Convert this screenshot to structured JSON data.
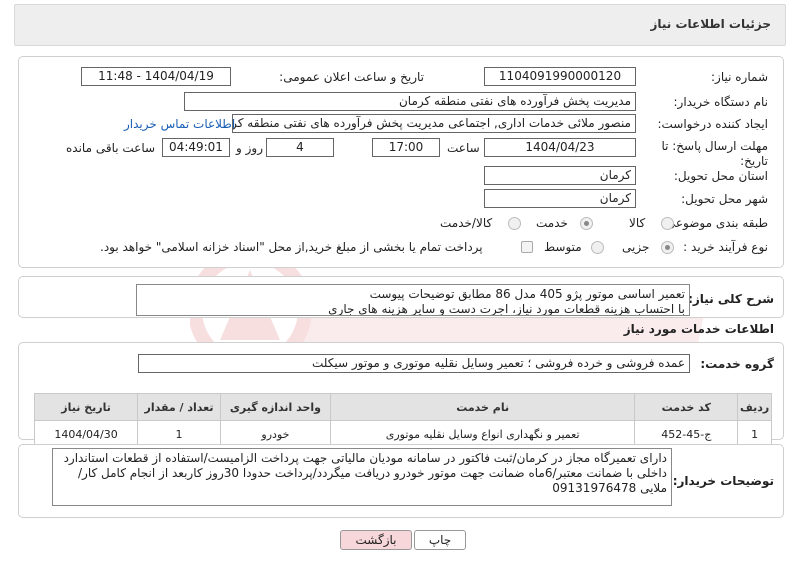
{
  "header": {
    "title": "جزئیات اطلاعات نیاز"
  },
  "form": {
    "need_number_label": "شماره نیاز:",
    "need_number": "1104091990000120",
    "announce_label": "تاریخ و ساعت اعلان عمومی:",
    "announce_value": "1404/04/19 - 11:48",
    "buyer_label": "نام دستگاه خریدار:",
    "buyer_value": "مدیریت پخش فرآورده های نفتی منطقه کرمان",
    "creator_label": "ایجاد کننده درخواست:",
    "creator_value": "منصور ملائی خدمات اداری, اجتماعی  مدیریت پخش فرآورده های نفتی منطقه کرمان",
    "contact_link": "اطلاعات تماس خریدار",
    "deadline_label": "مهلت ارسال پاسخ: تا تاریخ:",
    "deadline_date": "1404/04/23",
    "time_label": "ساعت",
    "deadline_time": "17:00",
    "days_value": "4",
    "days_label": "روز و",
    "remaining_time": "04:49:01",
    "remaining_label": "ساعت باقی مانده",
    "province_label": "استان محل تحویل:",
    "province_value": "کرمان",
    "city_label": "شهر محل تحویل:",
    "city_value": "کرمان",
    "category_label": "طبقه بندی موضوعی:",
    "category_options": [
      "کالا",
      "خدمت",
      "کالا/خدمت"
    ],
    "category_selected": "خدمت",
    "process_label": "نوع فرآیند خرید :",
    "process_options": [
      "جزیی",
      "متوسط"
    ],
    "process_selected": "جزیی",
    "payment_note": "پرداخت تمام یا بخشی از مبلغ خرید,از محل \"اسناد خزانه اسلامی\" خواهد بود."
  },
  "summary": {
    "label": "شرح کلی نیاز:",
    "text": "تعمیر اساسی موتور پژو 405 مدل 86 مطابق توضیحات پیوست\nبا احتساب هزینه قطعات مورد نیاز، اجرت دست و سایر هزینه های جاری"
  },
  "services": {
    "section_title": "اطلاعات خدمات مورد نیاز",
    "group_label": "گروه خدمت:",
    "group_value": "عمده فروشی و خرده فروشی ؛ تعمیر وسایل نقلیه موتوری و موتور سیکلت",
    "columns": [
      "ردیف",
      "کد خدمت",
      "نام خدمت",
      "واحد اندازه گیری",
      "تعداد / مقدار",
      "تاریخ نیاز"
    ],
    "rows": [
      [
        "1",
        "ج-45-452",
        "تعمیر و نگهداری انواع وسایل نقلیه موتوری",
        "خودرو",
        "1",
        "1404/04/30"
      ]
    ]
  },
  "buyer_notes": {
    "label": "توضیحات خریدار:",
    "text": "دارای تعمیرگاه مجاز در کرمان/ثبت فاکتور در سامانه مودیان مالیاتی جهت پرداخت الزامیست/استفاده از قطعات استاندارد داخلی با ضمانت معتبر/6ماه ضمانت جهت موتور خودرو دریافت میگردد/پرداخت حدودا 30روز کاربعد از انجام کامل کار/ملایی 09131976478"
  },
  "buttons": {
    "print": "چاپ",
    "back": "بازگشت"
  },
  "colors": {
    "back_button": "#f8d7da",
    "link": "#1a5fb4",
    "header_bg": "#eeeeee"
  }
}
